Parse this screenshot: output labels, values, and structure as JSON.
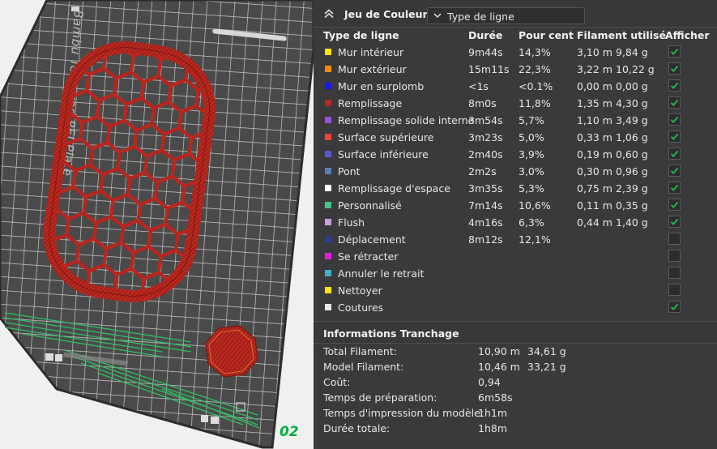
{
  "viewport": {
    "plate_label": "Bambu Textured PEI Plate",
    "plate_number": "02"
  },
  "legend": {
    "title": "Jeu de Couleur",
    "view_select_value": "Type de ligne",
    "columns": {
      "type": "Type de ligne",
      "duration": "Durée",
      "percent": "Pour cent",
      "filament": "Filament utilisé",
      "show": "Afficher"
    },
    "rows": [
      {
        "name": "Mur intérieur",
        "color": "#ffe600",
        "duration": "9m44s",
        "percent": "14,3%",
        "length": "3,10 m",
        "weight": "9,84 g",
        "checkbox": true,
        "checked": true
      },
      {
        "name": "Mur extérieur",
        "color": "#ff8a00",
        "duration": "15m11s",
        "percent": "22,3%",
        "length": "3,22 m",
        "weight": "10,22 g",
        "checkbox": true,
        "checked": true
      },
      {
        "name": "Mur en surplomb",
        "color": "#1515ff",
        "duration": "<1s",
        "percent": "<0.1%",
        "length": "0,00 m",
        "weight": "0,00 g",
        "checkbox": true,
        "checked": true
      },
      {
        "name": "Remplissage",
        "color": "#b02a2a",
        "duration": "8m0s",
        "percent": "11,8%",
        "length": "1,35 m",
        "weight": "4,30 g",
        "checkbox": true,
        "checked": true
      },
      {
        "name": "Remplissage solide interne",
        "color": "#9a4fd0",
        "duration": "3m54s",
        "percent": "5,7%",
        "length": "1,10 m",
        "weight": "3,49 g",
        "checkbox": true,
        "checked": true
      },
      {
        "name": "Surface supérieure",
        "color": "#f2412e",
        "duration": "3m23s",
        "percent": "5,0%",
        "length": "0,33 m",
        "weight": "1,06 g",
        "checkbox": true,
        "checked": true
      },
      {
        "name": "Surface inférieure",
        "color": "#5a56cc",
        "duration": "2m40s",
        "percent": "3,9%",
        "length": "0,19 m",
        "weight": "0,60 g",
        "checkbox": true,
        "checked": true
      },
      {
        "name": "Pont",
        "color": "#5a7fb5",
        "duration": "2m2s",
        "percent": "3,0%",
        "length": "0,30 m",
        "weight": "0,96 g",
        "checkbox": true,
        "checked": true
      },
      {
        "name": "Remplissage d'espace",
        "color": "#ffffff",
        "duration": "3m35s",
        "percent": "5,3%",
        "length": "0,75 m",
        "weight": "2,39 g",
        "checkbox": true,
        "checked": true
      },
      {
        "name": "Personnalisé",
        "color": "#44c48a",
        "duration": "7m14s",
        "percent": "10,6%",
        "length": "0,11 m",
        "weight": "0,35 g",
        "checkbox": true,
        "checked": true
      },
      {
        "name": "Flush",
        "color": "#caa0d8",
        "duration": "4m16s",
        "percent": "6,3%",
        "length": "0,44 m",
        "weight": "1,40 g",
        "checkbox": true,
        "checked": true
      },
      {
        "name": "Déplacement",
        "color": "#2f3f93",
        "duration": "8m12s",
        "percent": "12,1%",
        "length": "",
        "weight": "",
        "checkbox": true,
        "checked": false
      },
      {
        "name": "Se rétracter",
        "color": "#e21fe0",
        "duration": "",
        "percent": "",
        "length": "",
        "weight": "",
        "checkbox": true,
        "checked": false
      },
      {
        "name": "Annuler le retrait",
        "color": "#3fb1cc",
        "duration": "",
        "percent": "",
        "length": "",
        "weight": "",
        "checkbox": true,
        "checked": false
      },
      {
        "name": "Nettoyer",
        "color": "#ffe600",
        "duration": "",
        "percent": "",
        "length": "",
        "weight": "",
        "checkbox": true,
        "checked": false
      },
      {
        "name": "Coutures",
        "color": "#eaeaea",
        "duration": "",
        "percent": "",
        "length": "",
        "weight": "",
        "checkbox": true,
        "checked": true
      }
    ]
  },
  "slicing": {
    "title": "Informations Tranchage",
    "rows": [
      {
        "label": "Total Filament:",
        "v1": "10,90 m",
        "v2": "34,61 g"
      },
      {
        "label": "Model Filament:",
        "v1": "10,46 m",
        "v2": "33,21 g"
      },
      {
        "label": "Coût:",
        "v1": "0,94",
        "v2": ""
      },
      {
        "label": "Temps de préparation:",
        "v1": "6m58s",
        "v2": ""
      },
      {
        "label": "Temps d'impression du modèle:",
        "v1": "1h1m",
        "v2": ""
      },
      {
        "label": "Durée totale:",
        "v1": "1h8m",
        "v2": ""
      }
    ]
  },
  "colors": {
    "panel_bg": "#3a3a3c",
    "check_green": "#22b14c",
    "plate_number": "#00ae42",
    "print_red": "#b8261f"
  }
}
